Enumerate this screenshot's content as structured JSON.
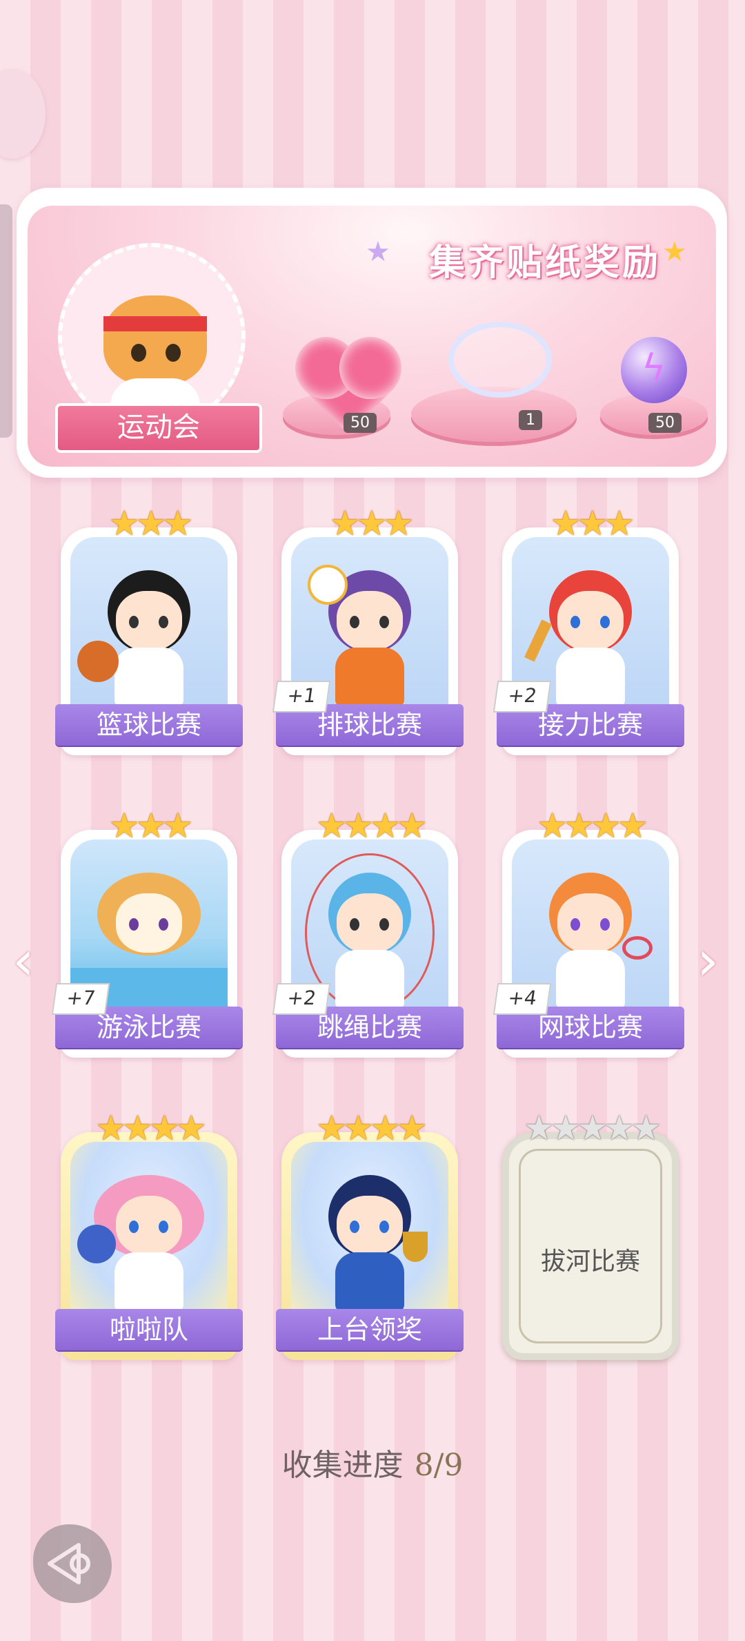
{
  "banner": {
    "title": "集齐贴纸奖励",
    "event_name": "运动会",
    "rewards": [
      {
        "icon": "pink-heart-gem-icon",
        "count": "50"
      },
      {
        "icon": "ribbon-bow-icon",
        "count": "1"
      },
      {
        "icon": "lightning-orb-icon",
        "count": "50"
      }
    ]
  },
  "cards": [
    {
      "label": "篮球比赛",
      "stars": "★★★",
      "bonus": ""
    },
    {
      "label": "排球比赛",
      "stars": "★★★",
      "bonus": "+1"
    },
    {
      "label": "接力比赛",
      "stars": "★★★",
      "bonus": "+2"
    },
    {
      "label": "游泳比赛",
      "stars": "★★★",
      "bonus": "+7"
    },
    {
      "label": "跳绳比赛",
      "stars": "★★★★",
      "bonus": "+2"
    },
    {
      "label": "网球比赛",
      "stars": "★★★★",
      "bonus": "+4"
    },
    {
      "label": "啦啦队",
      "stars": "★★★★",
      "bonus": ""
    },
    {
      "label": "上台领奖",
      "stars": "★★★★",
      "bonus": ""
    },
    {
      "label": "拔河比赛",
      "stars": "★★★★★",
      "bonus": "",
      "locked": true
    }
  ],
  "progress": {
    "label": "收集进度",
    "value": "8/9"
  },
  "nav": {
    "prev": "‹",
    "next": "›"
  },
  "colors": {
    "accent": "#8e68d6",
    "banner_pink": "#f7b9cb",
    "star_gold": "#ffc83a"
  }
}
